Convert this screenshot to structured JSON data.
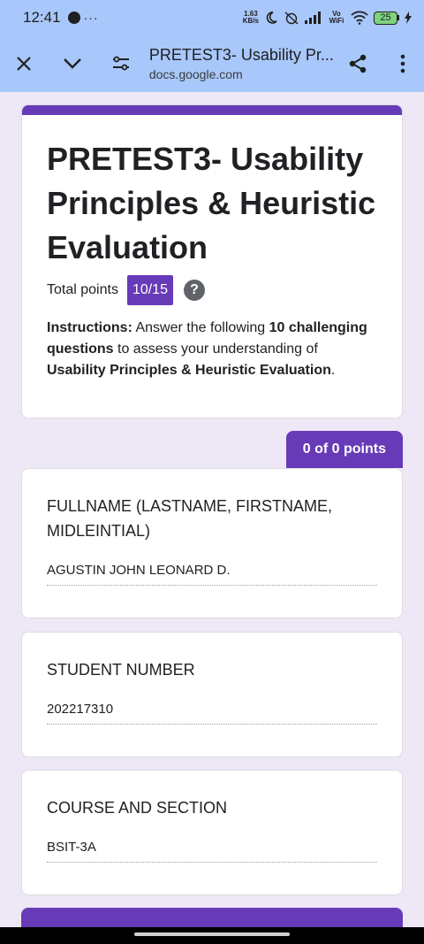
{
  "status_bar": {
    "time": "12:41",
    "more": "···",
    "net_speed_value": "1.63",
    "net_speed_unit": "KB/s",
    "network_label": "Vo WiFi",
    "battery": "25"
  },
  "toolbar": {
    "title": "PRETEST3- Usability Pr...",
    "url": "docs.google.com"
  },
  "form": {
    "title": "PRETEST3- Usability Principles & Heuristic Evaluation",
    "total_points_label": "Total points",
    "score": "10/15",
    "help": "?",
    "instructions": {
      "label": "Instructions:",
      "t1": " Answer the following ",
      "b1": "10 challenging questions",
      "t2": " to assess your understanding of ",
      "b2": "Usability Principles & Heuristic Evaluation",
      "t3": "."
    }
  },
  "section_points": "0 of 0 points",
  "questions": [
    {
      "title": "FULLNAME (LASTNAME, FIRSTNAME, MIDLEINTIAL)",
      "answer": "AGUSTIN JOHN LEONARD D."
    },
    {
      "title": "STUDENT NUMBER",
      "answer": "202217310"
    },
    {
      "title": "COURSE AND SECTION",
      "answer": "BSIT-3A"
    }
  ],
  "colors": {
    "accent": "#673ab7",
    "toolbar": "#a8c7fa",
    "background": "#ede7f6"
  }
}
